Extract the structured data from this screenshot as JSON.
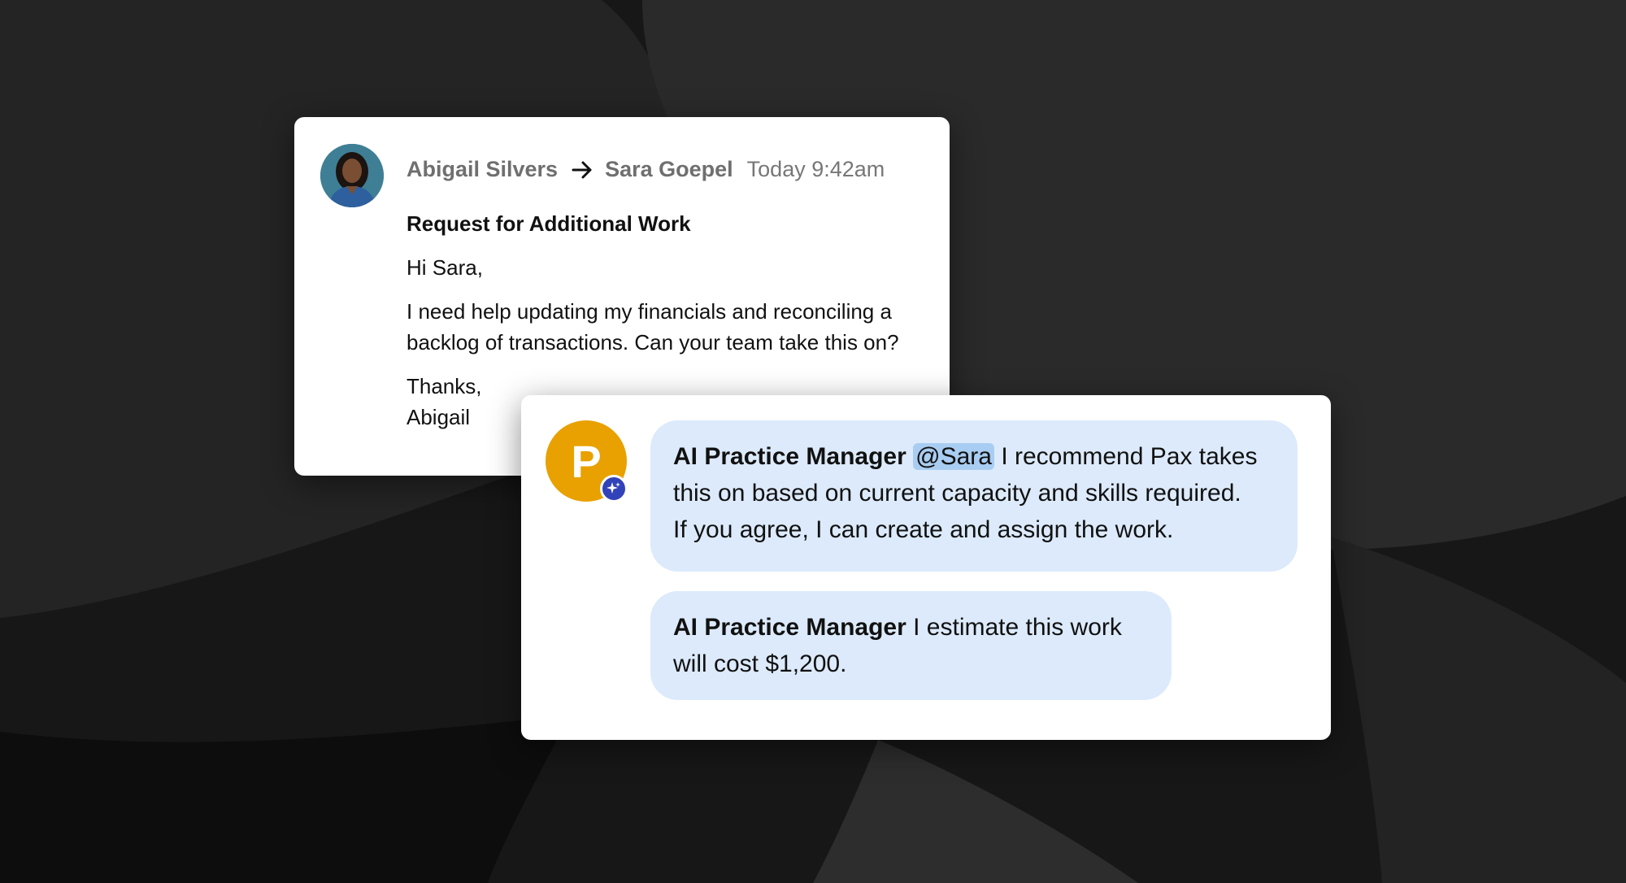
{
  "email": {
    "from": "Abigail Silvers",
    "to": "Sara Goepel",
    "time": "Today 9:42am",
    "subject": "Request for Additional Work",
    "greeting": "Hi Sara,",
    "body_line_1": "I need help updating my financials and reconciling a",
    "body_line_2": "backlog of transactions. Can your team take this on?",
    "closing": "Thanks,",
    "signature": "Abigail"
  },
  "ai": {
    "avatar_letter": "P",
    "messages": [
      {
        "speaker": "AI Practice Manager",
        "mention": "@Sara",
        "text_line_1": "I recommend Pax takes",
        "text_line_2": "this on based on current capacity and skills required.",
        "text_line_3": "If you agree, I can create and assign the work."
      },
      {
        "speaker": "AI Practice Manager",
        "text_line_1": "I estimate this work",
        "text_line_2": "will cost $1,200."
      }
    ]
  },
  "icons": {
    "arrow": "arrow-right-icon",
    "badge": "sparkle-icon"
  },
  "colors": {
    "avatar_bg": "#e8a100",
    "badge_bg": "#3242b8",
    "bubble_bg": "#dceafb",
    "mention_bg": "#a9cdf2"
  }
}
